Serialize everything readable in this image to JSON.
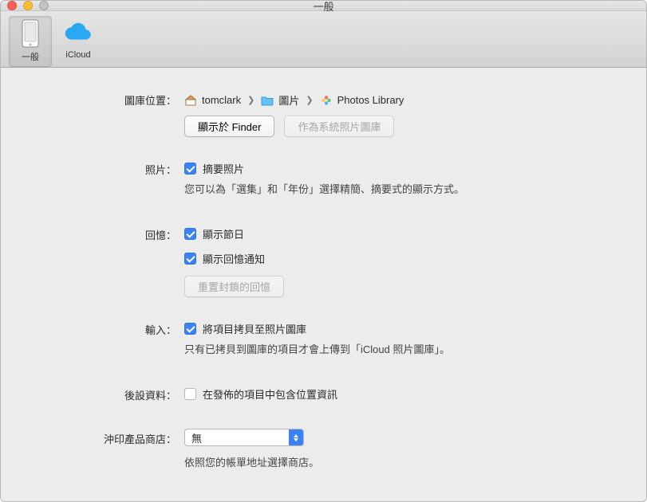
{
  "window": {
    "title": "一般"
  },
  "toolbar": {
    "tabs": [
      {
        "id": "general",
        "label": "一般",
        "selected": true
      },
      {
        "id": "icloud",
        "label": "iCloud",
        "selected": false
      }
    ]
  },
  "library_location": {
    "label": "圖庫位置：",
    "path": [
      {
        "icon": "home-icon",
        "text": "tomclark"
      },
      {
        "icon": "folder-icon",
        "text": "圖片"
      },
      {
        "icon": "photos-app-icon",
        "text": "Photos Library"
      }
    ],
    "show_in_finder": "顯示於 Finder",
    "set_as_system": "作為系統照片圖庫"
  },
  "photos": {
    "label": "照片：",
    "summarize": {
      "label": "摘要照片",
      "checked": true
    },
    "help": "您可以為「選集」和「年份」選擇精簡、摘要式的顯示方式。"
  },
  "memories": {
    "label": "回憶：",
    "show_holidays": {
      "label": "顯示節日",
      "checked": true
    },
    "show_notifications": {
      "label": "顯示回憶通知",
      "checked": true
    },
    "reset_button": "重置封鎖的回憶"
  },
  "importing": {
    "label": "輸入：",
    "copy_items": {
      "label": "將項目拷貝至照片圖庫",
      "checked": true
    },
    "help": "只有已拷貝到圖庫的項目才會上傳到「iCloud 照片圖庫」。"
  },
  "metadata": {
    "label": "後設資料：",
    "include_location": {
      "label": "在發佈的項目中包含位置資訊",
      "checked": false
    }
  },
  "print_store": {
    "label": "沖印產品商店：",
    "value": "無",
    "help": "依照您的帳單地址選擇商店。"
  }
}
